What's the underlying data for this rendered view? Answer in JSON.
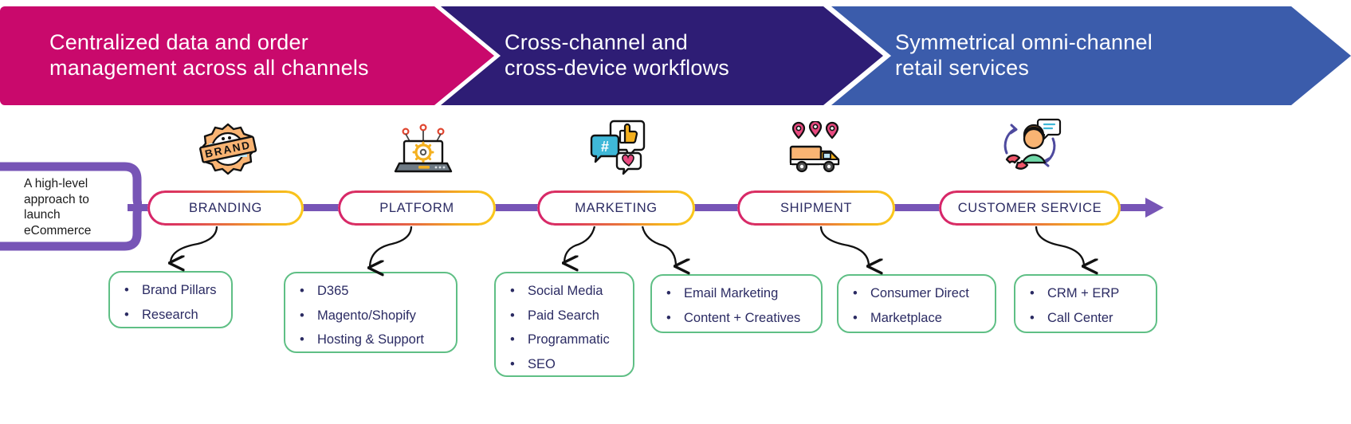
{
  "banners": [
    {
      "id": "banner-centralized-data",
      "text": "Centralized data and order\nmanagement across all channels",
      "color": "#C9096C"
    },
    {
      "id": "banner-cross-channel",
      "text": "Cross-channel and\ncross-device workflows",
      "color": "#2E1D75"
    },
    {
      "id": "banner-omni-channel",
      "text": "Symmetrical omni-channel\nretail services",
      "color": "#3B5CAB"
    }
  ],
  "callout": {
    "text": "A high-level approach to launch eCommerce",
    "color": "#7755B6"
  },
  "stages": [
    {
      "label": "BRANDING",
      "icon": "brand-badge-icon"
    },
    {
      "label": "PLATFORM",
      "icon": "laptop-gear-icon"
    },
    {
      "label": "MARKETING",
      "icon": "social-chat-icon"
    },
    {
      "label": "SHIPMENT",
      "icon": "delivery-truck-icon"
    },
    {
      "label": "CUSTOMER SERVICE",
      "icon": "support-agent-icon"
    }
  ],
  "detail_boxes": [
    {
      "stage": "BRANDING",
      "items": [
        "Brand Pillars",
        "Research"
      ]
    },
    {
      "stage": "PLATFORM",
      "items": [
        "D365",
        "Magento/Shopify",
        "Hosting & Support"
      ]
    },
    {
      "stage": "MARKETING",
      "items": [
        "Social Media",
        "Paid Search",
        "Programmatic",
        "SEO"
      ]
    },
    {
      "stage": "MARKETING",
      "items": [
        "Email Marketing",
        "Content + Creatives"
      ]
    },
    {
      "stage": "SHIPMENT",
      "items": [
        "Consumer Direct",
        "Marketplace"
      ]
    },
    {
      "stage": "CUSTOMER SERVICE",
      "items": [
        "CRM + ERP",
        "Call Center"
      ]
    }
  ],
  "bullet_glyph": "•",
  "colors": {
    "pill_border_start": "#D6246B",
    "pill_border_end": "#FBC91B",
    "connector": "#7755B6",
    "detail_border": "#5FBF85",
    "text_navy": "#2B2B63",
    "arrow": "#000000"
  }
}
